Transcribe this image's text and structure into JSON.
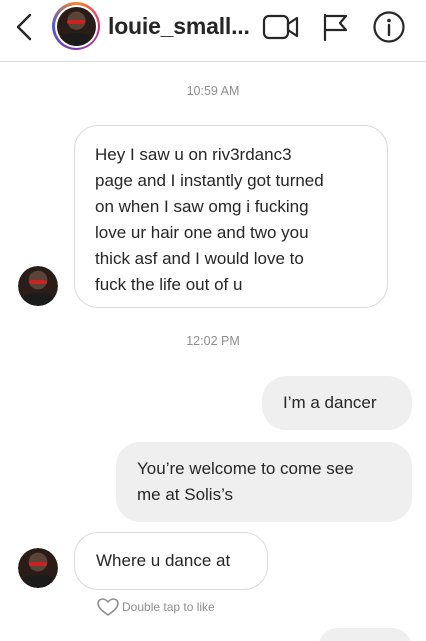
{
  "header": {
    "username": "louie_small...",
    "icons": {
      "back": "chevron-left-icon",
      "video": "video-camera-icon",
      "flag": "flag-icon",
      "info": "info-icon"
    }
  },
  "thread": {
    "timestamp_1": "10:59 AM",
    "msg_1_lines": [
      "Hey I saw u on riv3rdanc3",
      "page and I instantly got turned",
      "on when I saw omg i fucking",
      "love ur hair one and two you",
      "thick asf and I would love to",
      "fuck the life out of u"
    ],
    "timestamp_2": "12:02 PM",
    "msg_2": "I’m a dancer",
    "msg_3_lines": [
      "You’re welcome to come see",
      "me at Solis’s"
    ],
    "msg_4": "Where u dance at",
    "like_hint": "Double tap to like"
  },
  "colors": {
    "bubble_out": "#efefef",
    "border": "#dbdbdb",
    "meta_text": "#8e8e8e"
  }
}
